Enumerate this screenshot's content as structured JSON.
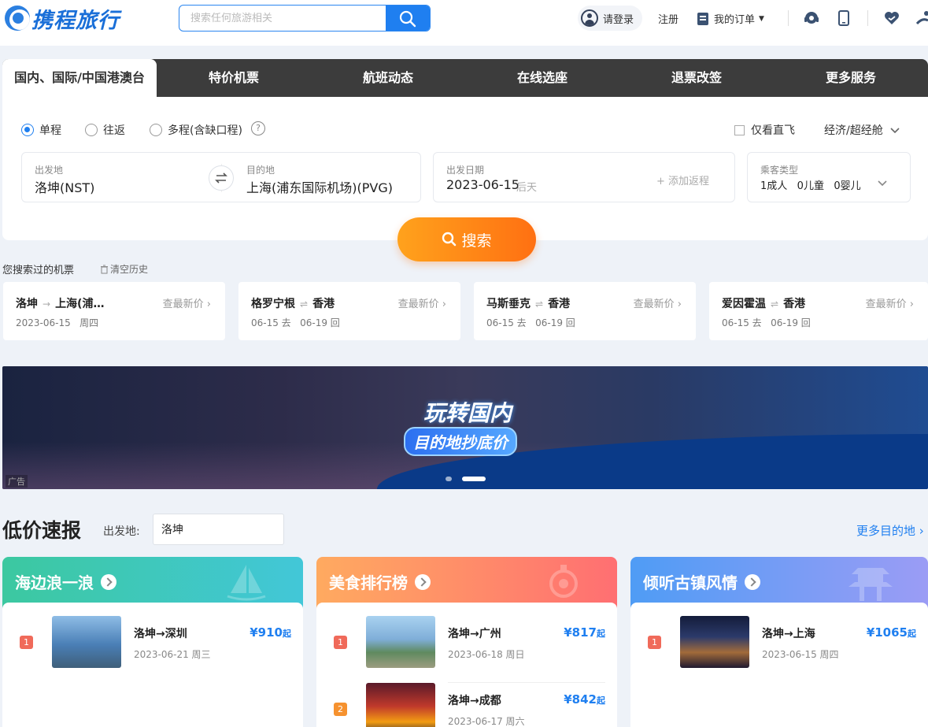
{
  "header": {
    "logo_text": "携程旅行",
    "search_placeholder": "搜索任何旅游相关",
    "login": "请登录",
    "register": "注册",
    "orders": "我的订单"
  },
  "tabs": [
    "国内、国际/中国港澳台",
    "特价机票",
    "航班动态",
    "在线选座",
    "退票改签",
    "更多服务"
  ],
  "trip_types": [
    "单程",
    "往返",
    "多程(含缺口程)"
  ],
  "selected_trip": "单程",
  "direct_only": "仅看直飞",
  "cabin": "经济/超经舱",
  "from": {
    "label": "出发地",
    "value": "洛坤(NST)"
  },
  "to": {
    "label": "目的地",
    "value": "上海(浦东国际机场)(PVG)"
  },
  "date": {
    "label": "出发日期",
    "value": "2023-06-15",
    "note": "后天",
    "add_return": "+ 添加返程"
  },
  "passengers": {
    "label": "乘客类型",
    "value": "1成人   0儿童   0婴儿"
  },
  "search_button": "搜索",
  "history": {
    "title": "您搜索过的机票",
    "clear": "清空历史",
    "items": [
      {
        "from": "洛坤",
        "to": "上海(浦…",
        "dates": "2023-06-15   周四",
        "price": "查最新价"
      },
      {
        "from": "格罗宁根",
        "to": "香港",
        "dates": "06-15 去   06-19 回",
        "price": "查最新价"
      },
      {
        "from": "马斯垂克",
        "to": "香港",
        "dates": "06-15 去   06-19 回",
        "price": "查最新价"
      },
      {
        "from": "爱因霍温",
        "to": "香港",
        "dates": "06-15 去   06-19 回",
        "price": "查最新价"
      }
    ]
  },
  "banner": {
    "title": "玩转国内",
    "subtitle": "目的地抄底价",
    "tag": "广告"
  },
  "deals": {
    "title": "低价速报",
    "departure_label": "出发地:",
    "departure_value": "洛坤",
    "more": "更多目的地 ›",
    "cards": [
      {
        "title": "海边浪一浪",
        "items": [
          {
            "rank": "1",
            "route": "洛坤→深圳",
            "date": "2023-06-21 周三",
            "price": "¥910",
            "suffix": "起"
          }
        ]
      },
      {
        "title": "美食排行榜",
        "items": [
          {
            "rank": "1",
            "route": "洛坤→广州",
            "date": "2023-06-18 周日",
            "price": "¥817",
            "suffix": "起"
          },
          {
            "rank": "2",
            "route": "洛坤→成都",
            "date": "2023-06-17 周六",
            "price": "¥842",
            "suffix": "起"
          }
        ]
      },
      {
        "title": "倾听古镇风情",
        "items": [
          {
            "rank": "1",
            "route": "洛坤→上海",
            "date": "2023-06-15 周四",
            "price": "¥1065",
            "suffix": "起"
          }
        ]
      }
    ]
  },
  "colors": {
    "primary": "#1f7ff0",
    "orange": "#ff7a12",
    "tabbar": "#3c3c3c"
  }
}
